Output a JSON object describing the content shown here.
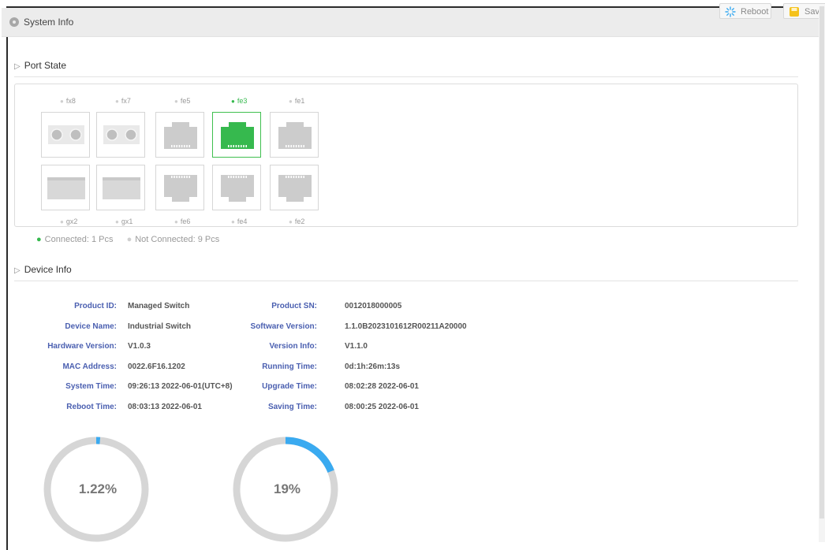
{
  "window": {
    "title": "System Info",
    "reboot_label": "Reboot",
    "save_label": "Save"
  },
  "port_state": {
    "heading": "Port State",
    "top_row": [
      {
        "name": "fx8",
        "type": "fiber",
        "connected": false
      },
      {
        "name": "fx7",
        "type": "fiber",
        "connected": false
      },
      {
        "name": "fe5",
        "type": "rj45",
        "connected": false
      },
      {
        "name": "fe3",
        "type": "rj45",
        "connected": true
      },
      {
        "name": "fe1",
        "type": "rj45",
        "connected": false
      }
    ],
    "bottom_row": [
      {
        "name": "gx2",
        "type": "sfp",
        "connected": false
      },
      {
        "name": "gx1",
        "type": "sfp",
        "connected": false
      },
      {
        "name": "fe6",
        "type": "rj45",
        "connected": false
      },
      {
        "name": "fe4",
        "type": "rj45",
        "connected": false
      },
      {
        "name": "fe2",
        "type": "rj45",
        "connected": false
      }
    ],
    "legend_connected": "Connected: 1 Pcs",
    "legend_not_connected": "Not Connected: 9 Pcs",
    "colors": {
      "connected": "#36b94e",
      "disconnected": "#cccccc"
    }
  },
  "device_info": {
    "heading": "Device Info",
    "rows": [
      {
        "label1": "Product ID:",
        "value1": "Managed Switch",
        "label2": "Product SN:",
        "value2": "0012018000005"
      },
      {
        "label1": "Device Name:",
        "value1": "Industrial Switch",
        "label2": "Software Version:",
        "value2": "1.1.0B2023101612R00211A20000"
      },
      {
        "label1": "Hardware Version:",
        "value1": "V1.0.3",
        "label2": "Version Info:",
        "value2": "V1.1.0"
      },
      {
        "label1": "MAC Address:",
        "value1": "0022.6F16.1202",
        "label2": "Running Time:",
        "value2": "0d:1h:26m:13s"
      },
      {
        "label1": "System Time:",
        "value1": "09:26:13 2022-06-01(UTC+8)",
        "label2": "Upgrade Time:",
        "value2": "08:02:28 2022-06-01"
      },
      {
        "label1": "Reboot Time:",
        "value1": "08:03:13 2022-06-01",
        "label2": "Saving Time:",
        "value2": "08:00:25 2022-06-01"
      }
    ]
  },
  "gauges": [
    {
      "text": "1.22%",
      "fraction": 0.0122
    },
    {
      "text": "19%",
      "fraction": 0.19
    }
  ],
  "colors": {
    "gauge_track": "#d6d6d6",
    "gauge_fill": "#3aaaf0",
    "label": "#4a5fb0"
  }
}
